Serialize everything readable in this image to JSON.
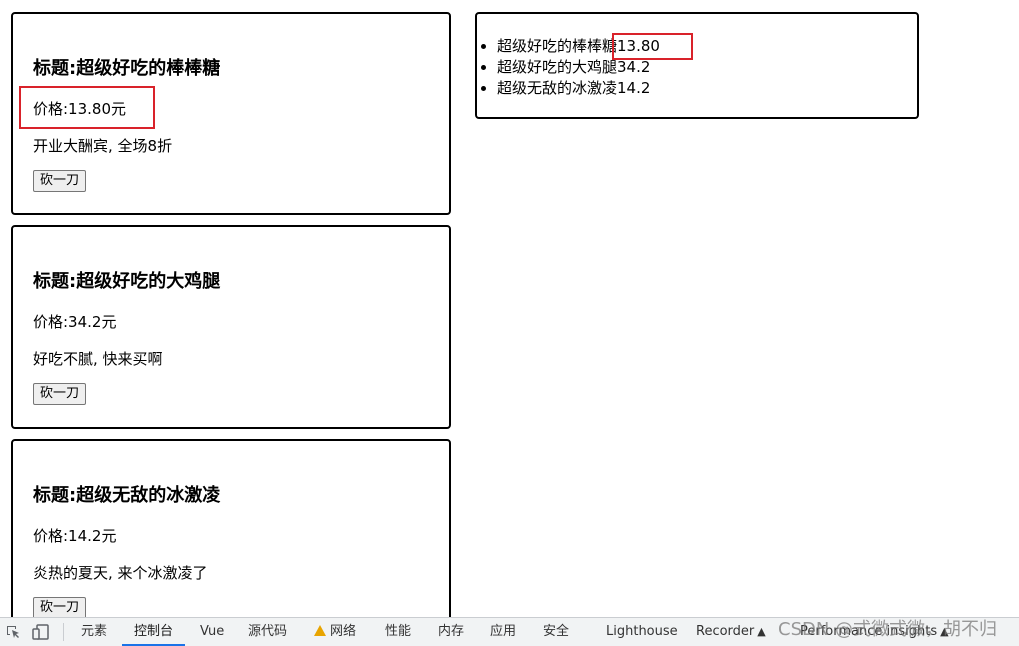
{
  "cards": [
    {
      "title": "标题:超级好吃的棒棒糖",
      "price": "价格:13.80元",
      "desc": "开业大酬宾, 全场8折",
      "button": "砍一刀"
    },
    {
      "title": "标题:超级好吃的大鸡腿",
      "price": "价格:34.2元",
      "desc": "好吃不腻, 快来买啊",
      "button": "砍一刀"
    },
    {
      "title": "标题:超级无敌的冰激凌",
      "price": "价格:14.2元",
      "desc": "炎热的夏天, 来个冰激凌了",
      "button": "砍一刀"
    }
  ],
  "summary_list": [
    "超级好吃的棒棒糖13.80",
    "超级好吃的大鸡腿34.2",
    "超级无敌的冰激凌14.2"
  ],
  "devtools": {
    "tabs": [
      "元素",
      "控制台",
      "Vue",
      "源代码",
      "网络",
      "性能",
      "内存",
      "应用",
      "安全",
      "Lighthouse",
      "Recorder",
      "Performance insights"
    ],
    "active_tab": "控制台",
    "warning_tab": "网络"
  },
  "watermark": "CSDN @式微式微，胡不归",
  "colors": {
    "highlight": "#d9222a",
    "active_tab_underline": "#1a73e8",
    "warning": "#e8a400"
  }
}
